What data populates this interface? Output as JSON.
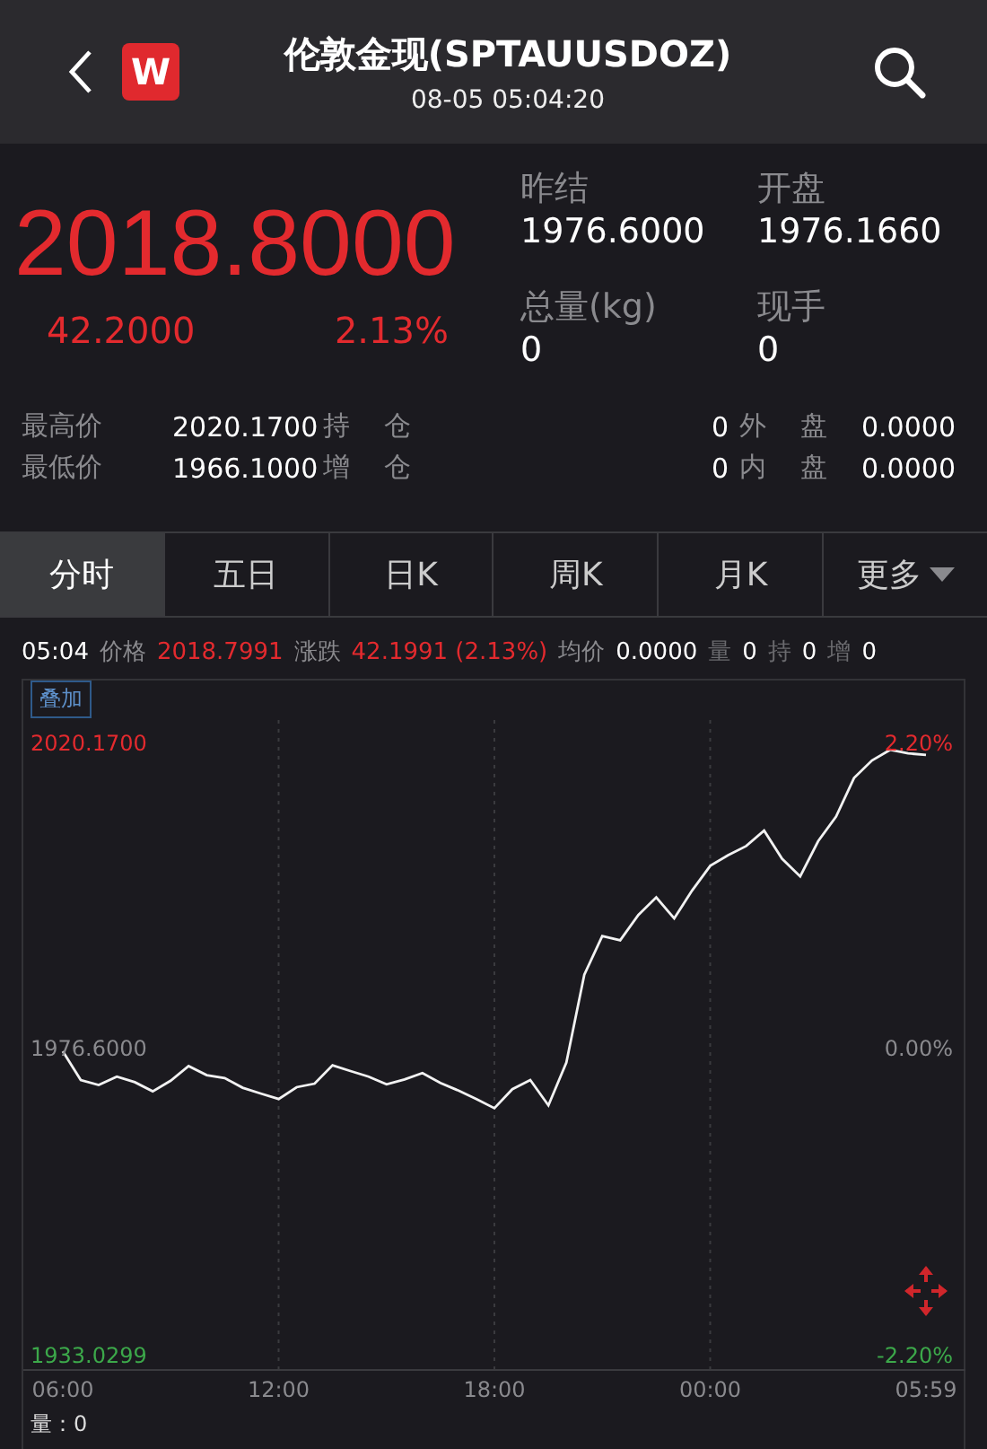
{
  "header": {
    "title": "伦敦金现(SPTAUUSDOZ)",
    "datetime": "08-05 05:04:20",
    "logo": "W"
  },
  "quote": {
    "price": "2018.8000",
    "change": "42.2000",
    "change_pct": "2.13%",
    "color": "#e32a2e",
    "stats": [
      {
        "label": "昨结",
        "value": "1976.6000"
      },
      {
        "label": "开盘",
        "value": "1976.1660"
      },
      {
        "label": "总量(kg)",
        "value": "0"
      },
      {
        "label": "现手",
        "value": "0"
      }
    ]
  },
  "details": [
    [
      {
        "label": "最高价",
        "value": "2020.1700"
      },
      {
        "label": "持 仓",
        "value": "0"
      },
      {
        "label": "外 盘",
        "value": "0.0000"
      }
    ],
    [
      {
        "label": "最低价",
        "value": "1966.1000"
      },
      {
        "label": "增 仓",
        "value": "0"
      },
      {
        "label": "内 盘",
        "value": "0.0000"
      }
    ]
  ],
  "tabs": [
    {
      "label": "分时",
      "selected": true,
      "kind": "tab"
    },
    {
      "label": "五日",
      "selected": false,
      "kind": "tab"
    },
    {
      "label": "日K",
      "selected": false,
      "kind": "tab"
    },
    {
      "label": "周K",
      "selected": false,
      "kind": "tab"
    },
    {
      "label": "月K",
      "selected": false,
      "kind": "tab"
    },
    {
      "label": "更多",
      "selected": false,
      "kind": "dropdown"
    }
  ],
  "ticker": {
    "time": "05:04",
    "items": [
      {
        "label": "价格",
        "value": "2018.7991",
        "color": "#e32a2e"
      },
      {
        "label": "涨跌",
        "value": "42.1991 (2.13%)",
        "color": "#e32a2e"
      },
      {
        "label": "均价",
        "value": "0.0000",
        "color": "#ffffff"
      },
      {
        "label": "量",
        "value": "0",
        "color": "#ffffff"
      },
      {
        "label": "持",
        "value": "0",
        "color": "#ffffff"
      },
      {
        "label": "增",
        "value": "0",
        "color": "#ffffff"
      }
    ]
  },
  "chart": {
    "overlay_button": "叠加",
    "levels": [
      {
        "pct": "2.20%",
        "color": "#e32a2e"
      },
      {
        "pct": "0.00%",
        "color": "#8a8a8e"
      },
      {
        "pct": "-2.20%",
        "color": "#3ca84a"
      }
    ],
    "volume": "量：0",
    "chart_data": {
      "type": "line",
      "ylim": [
        1933.0299,
        2020.17
      ],
      "yticks": [
        {
          "value": 2020.17,
          "label": "2020.1700"
        },
        {
          "value": 1976.6,
          "label": "1976.6000"
        },
        {
          "value": 1933.0299,
          "label": "1933.0299"
        }
      ],
      "grid": true,
      "categories": [
        "06:00",
        null,
        null,
        null,
        null,
        null,
        null,
        null,
        null,
        null,
        null,
        null,
        "12:00",
        null,
        null,
        null,
        null,
        null,
        null,
        null,
        null,
        null,
        null,
        null,
        "18:00",
        null,
        null,
        null,
        null,
        null,
        null,
        null,
        null,
        null,
        null,
        null,
        "00:00",
        null,
        null,
        null,
        null,
        null,
        null,
        null,
        null,
        null,
        null,
        null,
        "05:59"
      ],
      "series": [
        {
          "color": "#f2f2f2",
          "values": [
            1976.6,
            1972.5,
            1971.8,
            1973.0,
            1972.2,
            1970.9,
            1972.4,
            1974.5,
            1973.2,
            1972.8,
            1971.4,
            1970.6,
            1969.8,
            1971.5,
            1972.0,
            1974.6,
            1973.8,
            1973.0,
            1971.9,
            1972.6,
            1973.5,
            1972.1,
            1971.0,
            1969.8,
            1968.5,
            1971.2,
            1972.5,
            1968.9,
            1975.0,
            1987.5,
            1993.0,
            1992.4,
            1996.0,
            1998.5,
            1995.5,
            1999.5,
            2003.0,
            2004.5,
            2005.8,
            2008.0,
            2004.0,
            2001.5,
            2006.5,
            2010.0,
            2015.5,
            2018.0,
            2019.5,
            2019.0,
            2018.8
          ]
        }
      ]
    }
  }
}
